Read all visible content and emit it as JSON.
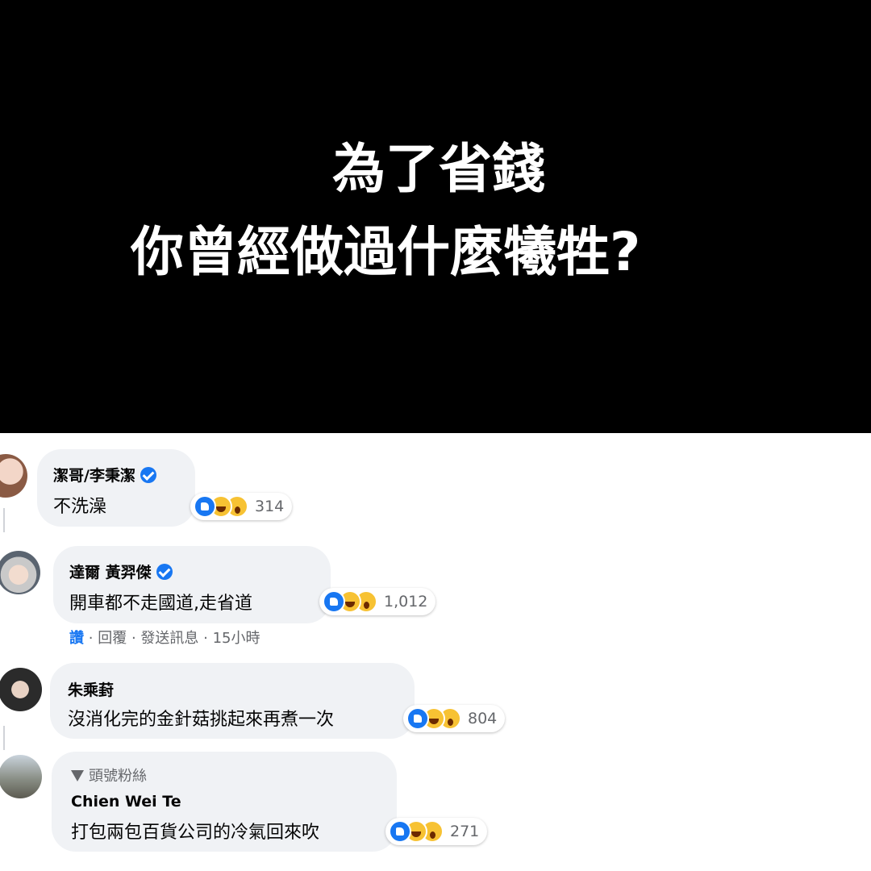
{
  "banner": {
    "line1": "為了省錢",
    "line2": "你曾經做過什麼犧牲?"
  },
  "comments": [
    {
      "author": "潔哥/李秉潔",
      "verified": true,
      "text": "不洗澡",
      "reaction_count": "314"
    },
    {
      "author": "達爾 黃羿傑",
      "verified": true,
      "text": "開車都不走國道,走省道",
      "reaction_count": "1,012",
      "actions": {
        "like": "讚",
        "sep1": "·",
        "reply": "回覆",
        "sep2": "·",
        "message": "發送訊息",
        "sep3": "·",
        "time": "15小時"
      }
    },
    {
      "author": "朱乘葑",
      "verified": false,
      "text": "沒消化完的金針菇挑起來再煮一次",
      "reaction_count": "804"
    },
    {
      "badge": "頭號粉絲",
      "author": "Chien Wei Te",
      "verified": false,
      "text": "打包兩包百貨公司的冷氣回來吹",
      "reaction_count": "271"
    }
  ],
  "colors": {
    "banner_bg": "#000000",
    "bubble_bg": "#f0f2f5",
    "link_blue": "#1877f2",
    "meta_gray": "#65676b"
  }
}
